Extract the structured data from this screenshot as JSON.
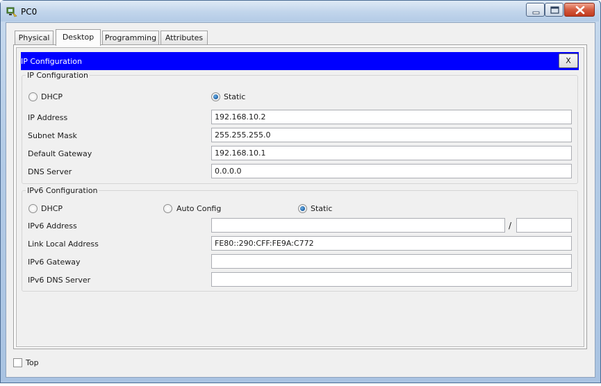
{
  "window": {
    "title": "PC0"
  },
  "tabs": [
    {
      "label": "Physical",
      "active": false
    },
    {
      "label": "Desktop",
      "active": true
    },
    {
      "label": "Programming",
      "active": false
    },
    {
      "label": "Attributes",
      "active": false
    }
  ],
  "panel": {
    "title": "IP Configuration",
    "close_label": "X"
  },
  "ipv4": {
    "group_label": "IP Configuration",
    "dhcp_label": "DHCP",
    "static_label": "Static",
    "mode": "static",
    "ip_address": {
      "label": "IP Address",
      "value": "192.168.10.2"
    },
    "subnet_mask": {
      "label": "Subnet Mask",
      "value": "255.255.255.0"
    },
    "default_gateway": {
      "label": "Default Gateway",
      "value": "192.168.10.1"
    },
    "dns_server": {
      "label": "DNS Server",
      "value": "0.0.0.0"
    }
  },
  "ipv6": {
    "group_label": "IPv6 Configuration",
    "dhcp_label": "DHCP",
    "auto_label": "Auto Config",
    "static_label": "Static",
    "mode": "static",
    "address": {
      "label": "IPv6 Address",
      "value": "",
      "prefix": ""
    },
    "prefix_separator": "/",
    "link_local": {
      "label": "Link Local Address",
      "value": "FE80::290:CFF:FE9A:C772"
    },
    "gateway": {
      "label": "IPv6 Gateway",
      "value": ""
    },
    "dns_server": {
      "label": "IPv6 DNS Server",
      "value": ""
    }
  },
  "footer": {
    "top_label": "Top",
    "top_checked": false
  },
  "colors": {
    "banner": "#0000ff",
    "titlebar": "#c3d6ec",
    "close_button": "#c23a1e"
  },
  "icons": [
    "packet-tracer-pc-icon",
    "minimize-icon",
    "maximize-icon",
    "close-icon",
    "radio-icon",
    "checkbox-icon"
  ]
}
